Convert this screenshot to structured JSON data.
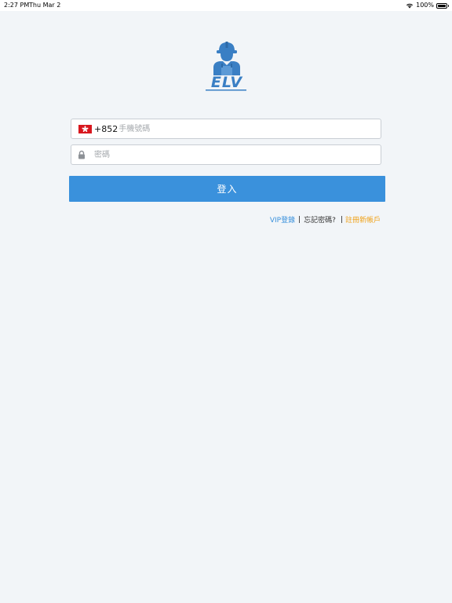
{
  "status_bar": {
    "time": "2:27 PM",
    "date": "Thu Mar 2",
    "battery_text": "100%",
    "wifi_icon": "wifi-icon",
    "battery_icon": "battery-icon"
  },
  "logo": {
    "text": "ELV",
    "icon": "worker-hardhat-icon",
    "brand_color": "#3a7fc4"
  },
  "login_form": {
    "phone": {
      "country_flag_icon": "hong-kong-flag-icon",
      "country_code": "+852",
      "placeholder": "手機號碼",
      "value": ""
    },
    "password": {
      "icon": "lock-icon",
      "placeholder": "密碼",
      "value": ""
    },
    "submit_label": "登入",
    "submit_color": "#3a91dc"
  },
  "links": {
    "vip_login": "VIP登錄",
    "separator": "|",
    "forgot_password": "忘記密碼?",
    "register": "註冊新帳戶",
    "vip_color": "#3a91dc",
    "register_color": "#f0a31b"
  }
}
